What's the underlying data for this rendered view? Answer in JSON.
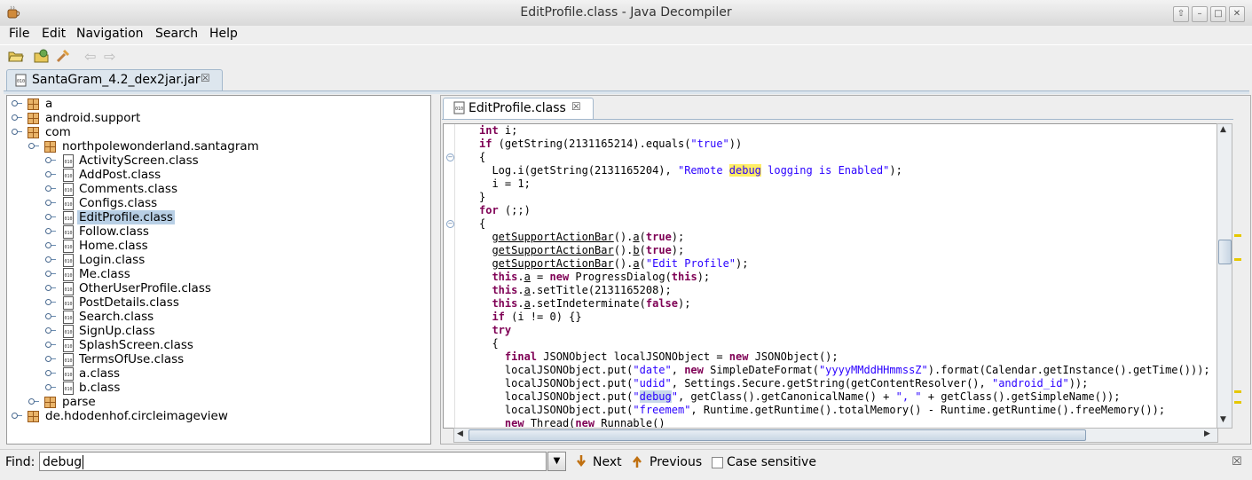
{
  "window": {
    "title": "EditProfile.class - Java Decompiler"
  },
  "menu": {
    "items": [
      "File",
      "Edit",
      "Navigation",
      "Search",
      "Help"
    ]
  },
  "toolbar": {
    "icons": [
      "open-file-icon",
      "open-type-icon",
      "search-type-icon",
      "back-arrow-icon",
      "forward-arrow-icon"
    ]
  },
  "outer_tab": {
    "label": "SantaGram_4.2_dex2jar.jar",
    "close": "☒"
  },
  "inner_tab": {
    "label": "EditProfile.class",
    "close": "☒"
  },
  "tree": {
    "rows": [
      {
        "label": "a",
        "kind": "pkg",
        "depth": 0
      },
      {
        "label": "android.support",
        "kind": "pkg",
        "depth": 0
      },
      {
        "label": "com",
        "kind": "pkg",
        "depth": 0
      },
      {
        "label": "northpolewonderland.santagram",
        "kind": "pkg",
        "depth": 1
      },
      {
        "label": "ActivityScreen.class",
        "kind": "cls",
        "depth": 2
      },
      {
        "label": "AddPost.class",
        "kind": "cls",
        "depth": 2
      },
      {
        "label": "Comments.class",
        "kind": "cls",
        "depth": 2
      },
      {
        "label": "Configs.class",
        "kind": "cls",
        "depth": 2
      },
      {
        "label": "EditProfile.class",
        "kind": "cls",
        "depth": 2,
        "selected": true
      },
      {
        "label": "Follow.class",
        "kind": "cls",
        "depth": 2
      },
      {
        "label": "Home.class",
        "kind": "cls",
        "depth": 2
      },
      {
        "label": "Login.class",
        "kind": "cls",
        "depth": 2
      },
      {
        "label": "Me.class",
        "kind": "cls",
        "depth": 2
      },
      {
        "label": "OtherUserProfile.class",
        "kind": "cls",
        "depth": 2
      },
      {
        "label": "PostDetails.class",
        "kind": "cls",
        "depth": 2
      },
      {
        "label": "Search.class",
        "kind": "cls",
        "depth": 2
      },
      {
        "label": "SignUp.class",
        "kind": "cls",
        "depth": 2
      },
      {
        "label": "SplashScreen.class",
        "kind": "cls",
        "depth": 2
      },
      {
        "label": "TermsOfUse.class",
        "kind": "cls",
        "depth": 2
      },
      {
        "label": "a.class",
        "kind": "cls",
        "depth": 2
      },
      {
        "label": "b.class",
        "kind": "cls",
        "depth": 2
      },
      {
        "label": "parse",
        "kind": "pkg",
        "depth": 1
      },
      {
        "label": "de.hdodenhof.circleimageview",
        "kind": "pkg",
        "depth": 0
      }
    ]
  },
  "code": {
    "lines": [
      [
        {
          "t": "int",
          "c": "kw"
        },
        {
          "t": " i;"
        }
      ],
      [
        {
          "t": "if",
          "c": "kw"
        },
        {
          "t": " (getString(2131165214).equals("
        },
        {
          "t": "\"true\"",
          "c": "str"
        },
        {
          "t": "))"
        }
      ],
      [
        {
          "t": "{"
        }
      ],
      [
        {
          "t": "  Log.i(getString(2131165204), "
        },
        {
          "t": "\"Remote ",
          "c": "str"
        },
        {
          "t": "debug",
          "c": "str hlY"
        },
        {
          "t": " logging is Enabled\"",
          "c": "str"
        },
        {
          "t": ");"
        }
      ],
      [
        {
          "t": "  i = 1;"
        }
      ],
      [
        {
          "t": "}"
        }
      ],
      [
        {
          "t": "for",
          "c": "kw"
        },
        {
          "t": " (;;)"
        }
      ],
      [
        {
          "t": "{"
        }
      ],
      [
        {
          "t": "  "
        },
        {
          "t": "getSupportActionBar",
          "c": "ul"
        },
        {
          "t": "()."
        },
        {
          "t": "a",
          "c": "ul"
        },
        {
          "t": "("
        },
        {
          "t": "true",
          "c": "kw"
        },
        {
          "t": ");"
        }
      ],
      [
        {
          "t": "  "
        },
        {
          "t": "getSupportActionBar",
          "c": "ul"
        },
        {
          "t": "()."
        },
        {
          "t": "b",
          "c": "ul"
        },
        {
          "t": "("
        },
        {
          "t": "true",
          "c": "kw"
        },
        {
          "t": ");"
        }
      ],
      [
        {
          "t": "  "
        },
        {
          "t": "getSupportActionBar",
          "c": "ul"
        },
        {
          "t": "()."
        },
        {
          "t": "a",
          "c": "ul"
        },
        {
          "t": "("
        },
        {
          "t": "\"Edit Profile\"",
          "c": "str"
        },
        {
          "t": ");"
        }
      ],
      [
        {
          "t": "  "
        },
        {
          "t": "this",
          "c": "kw"
        },
        {
          "t": "."
        },
        {
          "t": "a",
          "c": "ul"
        },
        {
          "t": " = "
        },
        {
          "t": "new",
          "c": "kw"
        },
        {
          "t": " ProgressDialog("
        },
        {
          "t": "this",
          "c": "kw"
        },
        {
          "t": ");"
        }
      ],
      [
        {
          "t": "  "
        },
        {
          "t": "this",
          "c": "kw"
        },
        {
          "t": "."
        },
        {
          "t": "a",
          "c": "ul"
        },
        {
          "t": ".setTitle(2131165208);"
        }
      ],
      [
        {
          "t": "  "
        },
        {
          "t": "this",
          "c": "kw"
        },
        {
          "t": "."
        },
        {
          "t": "a",
          "c": "ul"
        },
        {
          "t": ".setIndeterminate("
        },
        {
          "t": "false",
          "c": "kw"
        },
        {
          "t": ");"
        }
      ],
      [
        {
          "t": "  "
        },
        {
          "t": "if",
          "c": "kw"
        },
        {
          "t": " (i != 0) {}"
        }
      ],
      [
        {
          "t": "  "
        },
        {
          "t": "try",
          "c": "kw"
        }
      ],
      [
        {
          "t": "  {"
        }
      ],
      [
        {
          "t": "    "
        },
        {
          "t": "final",
          "c": "kw"
        },
        {
          "t": " JSONObject localJSONObject = "
        },
        {
          "t": "new",
          "c": "kw"
        },
        {
          "t": " JSONObject();"
        }
      ],
      [
        {
          "t": "    localJSONObject.put("
        },
        {
          "t": "\"date\"",
          "c": "str"
        },
        {
          "t": ", "
        },
        {
          "t": "new",
          "c": "kw"
        },
        {
          "t": " SimpleDateFormat("
        },
        {
          "t": "\"yyyyMMddHHmmssZ\"",
          "c": "str"
        },
        {
          "t": ").format(Calendar.getInstance().getTime()));"
        }
      ],
      [
        {
          "t": "    localJSONObject.put("
        },
        {
          "t": "\"udid\"",
          "c": "str"
        },
        {
          "t": ", Settings.Secure.getString(getContentResolver(), "
        },
        {
          "t": "\"android_id\"",
          "c": "str"
        },
        {
          "t": "));"
        }
      ],
      [
        {
          "t": "    localJSONObject.put("
        },
        {
          "t": "\"",
          "c": "str"
        },
        {
          "t": "debug",
          "c": "str hlB"
        },
        {
          "t": "\"",
          "c": "str"
        },
        {
          "t": ", getClass().getCanonicalName() + "
        },
        {
          "t": "\", \"",
          "c": "str"
        },
        {
          "t": " + getClass().getSimpleName());"
        }
      ],
      [
        {
          "t": "    localJSONObject.put("
        },
        {
          "t": "\"freemem\"",
          "c": "str"
        },
        {
          "t": ", Runtime.getRuntime().totalMemory() - Runtime.getRuntime().freeMemory());"
        }
      ],
      [
        {
          "t": "    "
        },
        {
          "t": "new",
          "c": "kw"
        },
        {
          "t": " Thread("
        },
        {
          "t": "new",
          "c": "kw"
        },
        {
          "t": " Runnable()"
        }
      ]
    ]
  },
  "find": {
    "label": "Find:",
    "value": "debug",
    "next_label": "Next",
    "previous_label": "Previous",
    "case_label": "Case sensitive",
    "case_checked": false,
    "close": "☒"
  },
  "colors": {
    "keyword": "#7f0055",
    "string": "#2a00ff",
    "highlight": "#ffee66",
    "selection": "#b8cfe5"
  }
}
